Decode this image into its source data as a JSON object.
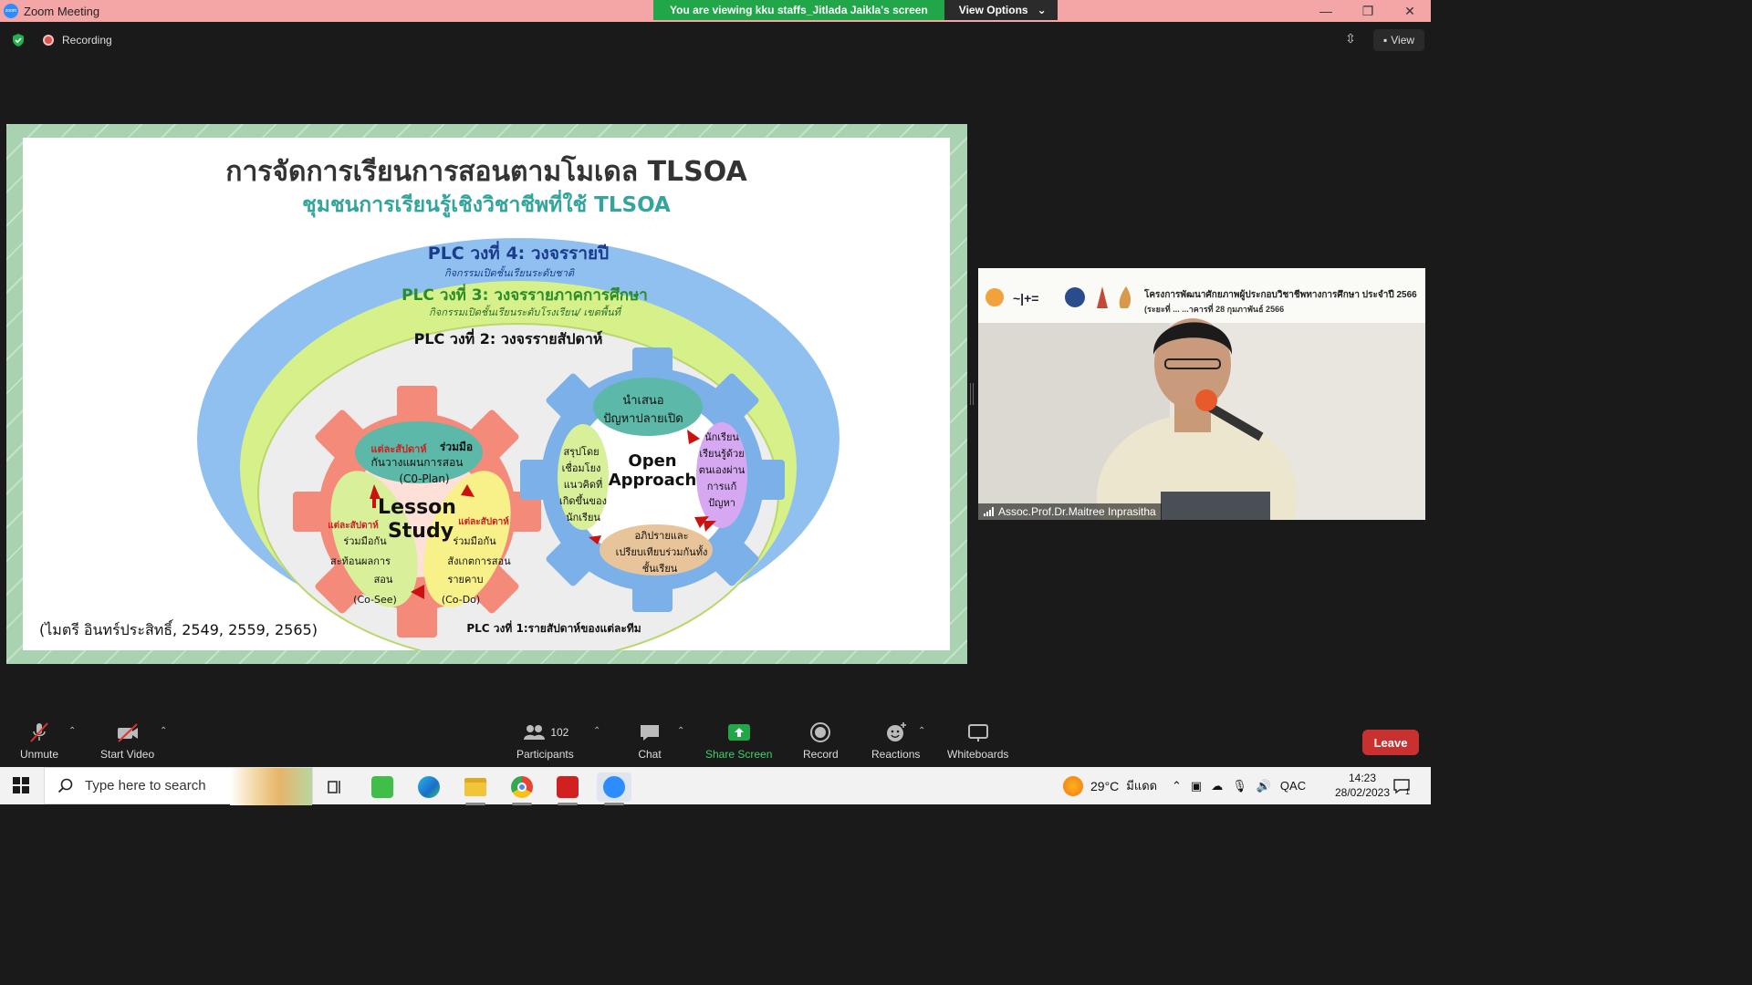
{
  "window": {
    "title": "Zoom Meeting",
    "banner_text": "You are viewing kku staffs_Jitlada Jaikla's screen",
    "view_options_label": "View Options",
    "controls": {
      "minimize": "—",
      "maximize": "❐",
      "close": "✕"
    }
  },
  "topbar": {
    "recording_label": "Recording",
    "view_label": "View"
  },
  "slide": {
    "title": "การจัดการเรียนการสอนตามโมเดล TLSOA",
    "subtitle": "ชุมชนการเรียนรู้เชิงวิชาชีพที่ใช้ TLSOA",
    "plc4_title": "PLC วงที่ 4: วงจรรายปี",
    "plc4_sub": "กิจกรรมเปิดชั้นเรียนระดับชาติ",
    "plc3_title": "PLC วงที่ 3: วงจรรายภาคการศึกษา",
    "plc3_sub": "กิจกรรมเปิดชั้นเรียนระดับโรงเรียน/ เขตพื้นที่",
    "plc2_title": "PLC วงที่ 2: วงจรรายสัปดาห์",
    "plc1_title": "PLC วงที่ 1:รายสัปดาห์ของแต่ละทีม",
    "lesson_study_1": "Lesson",
    "lesson_study_2": "Study",
    "plan_weekly": "แต่ละสัปดาห์",
    "plan_join": "ร่วมมือ",
    "plan_line2": "กันวางแผนการสอน",
    "plan_code": "(C0-Plan)",
    "see_weekly": "แต่ละสัปดาห์",
    "see_line1": "ร่วมมือกัน",
    "see_line2": "สะท้อนผลการ",
    "see_line3": "สอน",
    "see_code": "(Co-See)",
    "do_weekly": "แต่ละสัปดาห์",
    "do_line1": "ร่วมมือกัน",
    "do_line2": "สังเกตการสอน",
    "do_line3": "รายคาบ",
    "do_code": "(Co-Do)",
    "open_approach_1": "Open",
    "open_approach_2": "Approach",
    "oa_top_1": "นำเสนอ",
    "oa_top_2": "ปัญหาปลายเปิด",
    "oa_right_1": "นักเรียน",
    "oa_right_2": "เรียนรู้ด้วย",
    "oa_right_3": "ตนเองผ่าน",
    "oa_right_4": "การแก้",
    "oa_right_5": "ปัญหา",
    "oa_bottom_1": "อภิปรายและ",
    "oa_bottom_2": "เปรียบเทียบร่วมกันทั้ง",
    "oa_bottom_3": "ชั้นเรียน",
    "oa_left_1": "สรุปโดย",
    "oa_left_2": "เชื่อมโยง",
    "oa_left_3": "แนวคิดที่",
    "oa_left_4": "เกิดขึ้นของ",
    "oa_left_5": "นักเรียน",
    "citation": "(ไมตรี อินทร์ประสิทธิ์, 2549, 2559, 2565)"
  },
  "video": {
    "participant_name": "Assoc.Prof.Dr.Maitree Inprasitha",
    "banner_title": "โครงการพัฒนาศักยภาพผู้ประกอบวิชาชีพทางการศึกษา ประจำปี 2566",
    "banner_sub": "(ระยะที่ ...  ...าคารที่ 28 กุมภาพันธ์ 2566"
  },
  "toolbar": {
    "unmute": "Unmute",
    "start_video": "Start Video",
    "participants": "Participants",
    "participants_count": "102",
    "chat": "Chat",
    "share_screen": "Share Screen",
    "record": "Record",
    "reactions": "Reactions",
    "whiteboards": "Whiteboards",
    "leave": "Leave"
  },
  "taskbar": {
    "search_placeholder": "Type here to search",
    "temperature": "29°C",
    "weather": "มีแดด",
    "language": "QAC",
    "time": "14:23",
    "date": "28/02/2023",
    "notification_count": "1"
  },
  "colors": {
    "share_green": "#21a64a",
    "leave_red": "#c8312f",
    "plc4_blue": "#8fc0f0",
    "plc3_lime": "#d6f08a",
    "gear_salmon": "#f48a7a",
    "gear_blue": "#7bb0e8"
  }
}
